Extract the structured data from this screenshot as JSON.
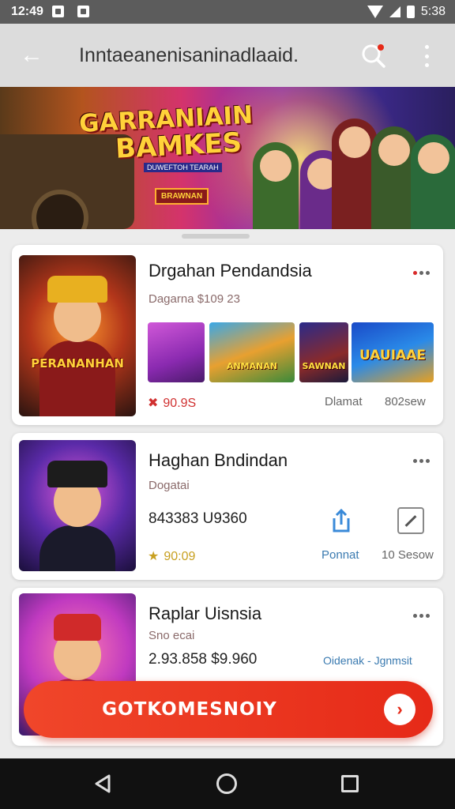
{
  "status_bar": {
    "time": "12:49",
    "battery": "5:38"
  },
  "app_bar": {
    "title": "Inntaeanenisaninadlaaid.",
    "icons": [
      "back-arrow-icon",
      "search-icon",
      "more-vert-icon"
    ]
  },
  "banner": {
    "title_line1": "GARRANIAIN",
    "title_line2": "BAMKES",
    "caption": "DUWEFTOH TEARAH",
    "badge": "BRAWNAN"
  },
  "cards": [
    {
      "name": "Drgahan Pendandsia",
      "subtitle": "Dagarna $109 23",
      "thumb_label": "PERANANHAN",
      "screenshots": [
        {
          "caption": ""
        },
        {
          "caption": "ANMANAN"
        },
        {
          "caption": "SAWNAN"
        },
        {
          "caption": "UAUIAAE"
        }
      ],
      "rating": "90.9S",
      "meta_left": "Dlamat",
      "meta_right": "802sew"
    },
    {
      "name": "Haghan Bndindan",
      "subtitle": "Dogatai",
      "numbers": "843383 U9360",
      "rating": "90:09",
      "meta_left": "Ponnat",
      "meta_right": "10 Sesow"
    },
    {
      "name": "Raplar Uisnsia",
      "subtitle": "Sno ecai",
      "numbers": "2.93.858 $9.960",
      "meta_left": "Oidenak - Jgnmsit"
    }
  ],
  "fab": {
    "label": "GOTKOMESNOIY"
  },
  "colors": {
    "accent": "#e62a18",
    "appbar": "#dcdcdc",
    "statusbar": "#5c5c5c"
  }
}
